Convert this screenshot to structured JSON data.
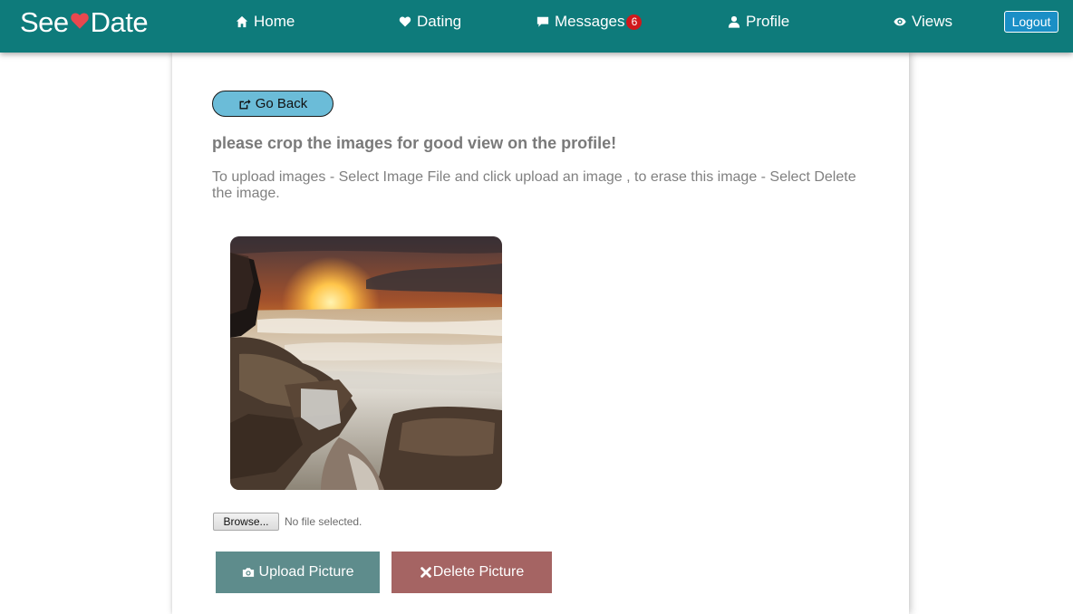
{
  "nav": {
    "brand_left": "See",
    "brand_right": "Date",
    "brand_heart_icon": "heart-icon",
    "brand_heart_color": "#e8484f",
    "bar_color": "#0e7b7b",
    "items": [
      {
        "label": "Home",
        "icon": "home-icon"
      },
      {
        "label": "Dating",
        "icon": "heart-icon"
      },
      {
        "label": "Messages",
        "icon": "comment-icon",
        "badge": "6"
      },
      {
        "label": "Profile",
        "icon": "user-icon"
      },
      {
        "label": "Views",
        "icon": "eye-icon"
      }
    ],
    "logout_label": "Logout"
  },
  "main": {
    "go_back_label": "Go Back",
    "go_back_icon": "share-icon",
    "heading": "please crop the images for good view on the profile!",
    "instructions": "To upload images - Select Image File and click upload an image , to erase this image - Select Delete the image.",
    "photo_name": "sunset-seascape-photo",
    "file_input": {
      "browse_label": "Browse...",
      "status": "No file selected."
    },
    "upload_label": "Upload Picture",
    "upload_icon": "camera-icon",
    "delete_label": "Delete Picture",
    "delete_icon": "close-icon",
    "colors": {
      "go_back_bg": "#6bbcd8",
      "upload_bg": "#5e8c8c",
      "delete_bg": "#a56463"
    }
  }
}
